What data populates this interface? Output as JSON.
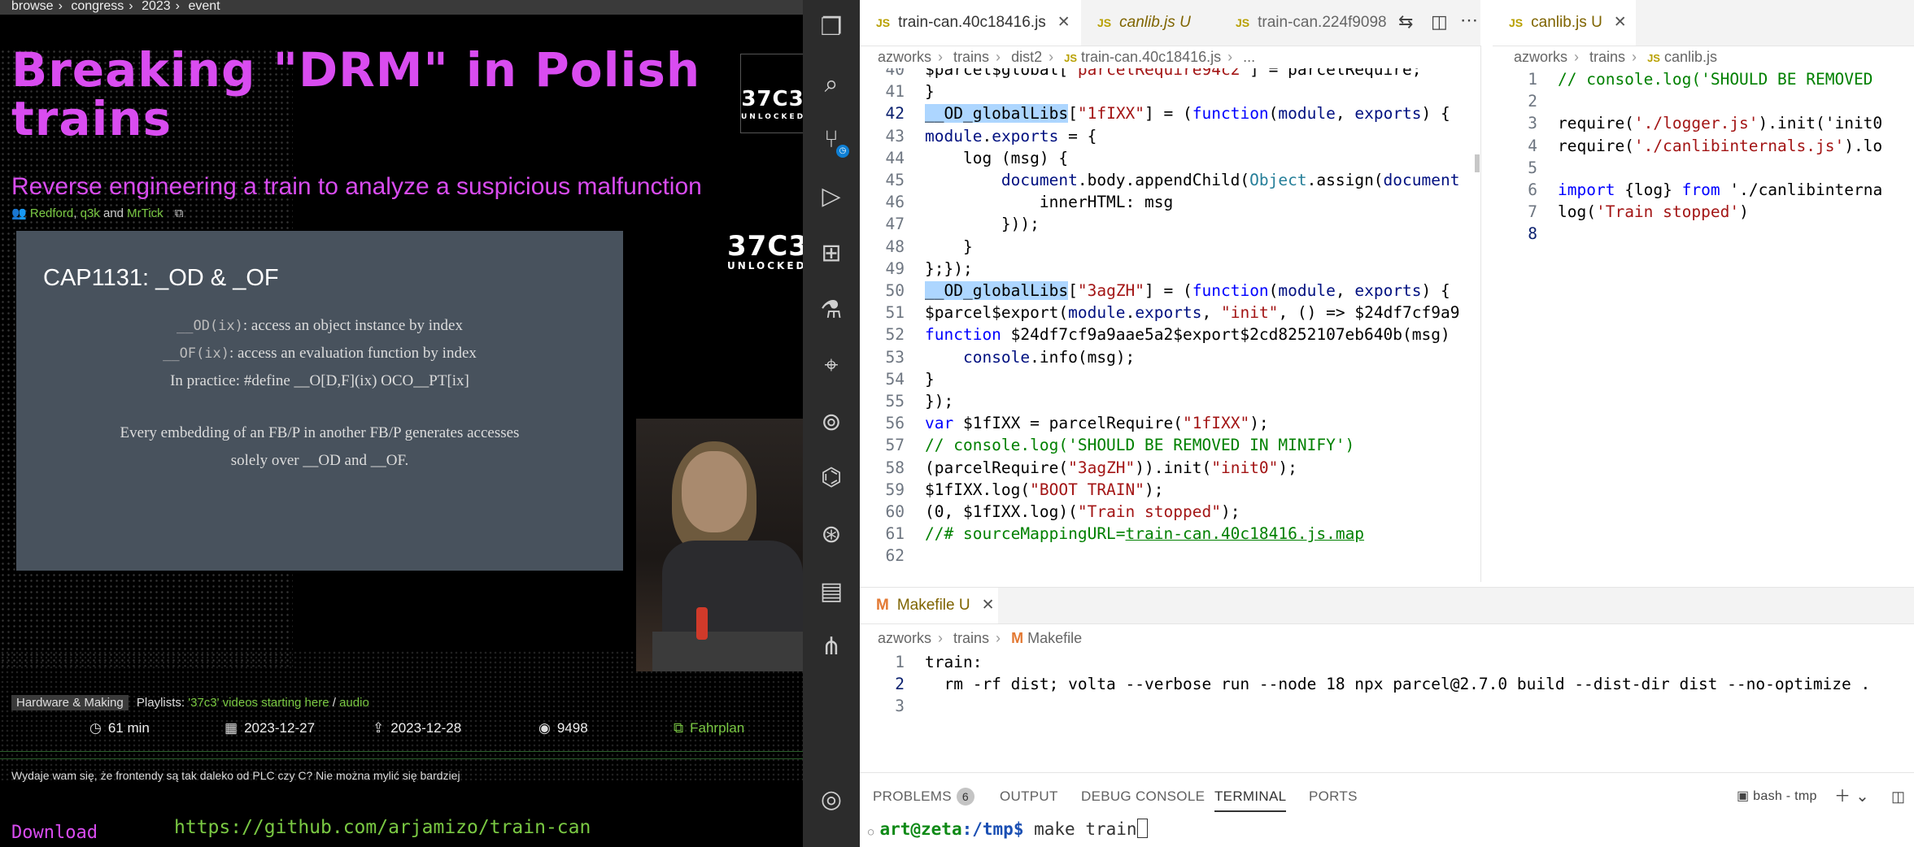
{
  "browser": {
    "breadcrumb": [
      "browse",
      "congress",
      "2023",
      "event"
    ],
    "title": "Breaking \"DRM\" in Polish trains",
    "subtitle": "Reverse engineering a train to analyze a suspicious malfunction",
    "speakers": [
      "Redford",
      "q3k",
      "MrTick"
    ],
    "speakers_and": "and",
    "logo_big": "37C3",
    "logo_small": "UNLOCKED",
    "slide": {
      "title": "CAP1131: _OD & _OF",
      "line1_code": "__OD(ix)",
      "line1_text": ": access an object instance by index",
      "line2_code": "__OF(ix)",
      "line2_text": ": access an evaluation function by index",
      "line3": "In practice: #define __O[D,F](ix) OCO__PT[ix]",
      "para": "Every embedding of an FB/P in another FB/P generates accesses solely over __OD and __OF."
    },
    "tag": "Hardware & Making",
    "playlists_label": "Playlists:",
    "playlist_link": "'37c3' videos starting here",
    "playlist_sep": "/",
    "audio_link": "audio",
    "duration": "61 min",
    "date_recorded": "2023-12-27",
    "date_released": "2023-12-28",
    "views": "9498",
    "fahrplan": "Fahrplan",
    "description": "Wydaje wam się, że frontendy są tak daleko od PLC czy C? Nie można mylić się bardziej",
    "download_label": "Download",
    "repo_url": "https://github.com/arjamizo/train-can"
  },
  "vscode": {
    "tabs_left": [
      {
        "label": "train-can.40c18416.js",
        "status": ""
      },
      {
        "label": "canlib.js",
        "status": "U"
      },
      {
        "label": "train-can.224f9098",
        "status": ""
      }
    ],
    "breadcrumb_left": [
      "azworks",
      "trains",
      "dist2",
      "train-can.40c18416.js",
      "..."
    ],
    "tab_right": {
      "label": "canlib.js",
      "status": "U"
    },
    "breadcrumb_right": [
      "azworks",
      "trains",
      "canlib.js"
    ],
    "code_left": [
      {
        "n": "40",
        "t": "$parcel$global[\"parcelRequire94c2\"] = parcelRequire;"
      },
      {
        "n": "41",
        "t": "}"
      },
      {
        "n": "42",
        "t": "__OD_globalLibs[\"1fIXX\"] = (function(module, exports) {"
      },
      {
        "n": "43",
        "t": "module.exports = {"
      },
      {
        "n": "44",
        "t": "    log (msg) {"
      },
      {
        "n": "45",
        "t": "        document.body.appendChild(Object.assign(document"
      },
      {
        "n": "46",
        "t": "            innerHTML: msg"
      },
      {
        "n": "47",
        "t": "        }));"
      },
      {
        "n": "48",
        "t": "    }"
      },
      {
        "n": "49",
        "t": "};});"
      },
      {
        "n": "50",
        "t": "__OD_globalLibs[\"3agZH\"] = (function(module, exports) {"
      },
      {
        "n": "51",
        "t": "$parcel$export(module.exports, \"init\", () => $24df7cf9a9"
      },
      {
        "n": "52",
        "t": "function $24df7cf9a9aae5a2$export$2cd8252107eb640b(msg)"
      },
      {
        "n": "53",
        "t": "    console.info(msg);"
      },
      {
        "n": "54",
        "t": "}"
      },
      {
        "n": "55",
        "t": "});"
      },
      {
        "n": "56",
        "t": "var $1fIXX = parcelRequire(\"1fIXX\");"
      },
      {
        "n": "57",
        "t": "// console.log('SHOULD BE REMOVED IN MINIFY')"
      },
      {
        "n": "58",
        "t": "(parcelRequire(\"3agZH\")).init(\"init0\");"
      },
      {
        "n": "59",
        "t": "$1fIXX.log(\"BOOT TRAIN\");"
      },
      {
        "n": "60",
        "t": "(0, $1fIXX.log)(\"Train stopped\");"
      },
      {
        "n": "61",
        "t": "//# sourceMappingURL=train-can.40c18416.js.map"
      },
      {
        "n": "62",
        "t": ""
      }
    ],
    "code_right": [
      {
        "n": "1",
        "t": "// console.log('SHOULD BE REMOVED"
      },
      {
        "n": "2",
        "t": ""
      },
      {
        "n": "3",
        "t": "require('./logger.js').init('init0"
      },
      {
        "n": "4",
        "t": "require('./canlibinternals.js').lo"
      },
      {
        "n": "5",
        "t": ""
      },
      {
        "n": "6",
        "t": "import {log} from './canlibinterna"
      },
      {
        "n": "7",
        "t": "log('Train stopped')"
      },
      {
        "n": "8",
        "t": ""
      }
    ],
    "makefile_tab": {
      "label": "Makefile",
      "status": "U"
    },
    "makefile_breadcrumb": [
      "azworks",
      "trains",
      "Makefile"
    ],
    "makefile_lines": [
      {
        "n": "1",
        "t": "train:"
      },
      {
        "n": "2",
        "t": "  rm -rf dist; volta --verbose run --node 18 npx parcel@2.7.0 build --dist-dir dist --no-optimize ."
      },
      {
        "n": "3",
        "t": ""
      }
    ],
    "panel_tabs": [
      "PROBLEMS",
      "OUTPUT",
      "DEBUG CONSOLE",
      "TERMINAL",
      "PORTS"
    ],
    "problems_count": "6",
    "terminal_label": "bash - tmp",
    "terminal_user": "art@zeta",
    "terminal_path": ":/tmp$",
    "terminal_cmd": " make train"
  }
}
